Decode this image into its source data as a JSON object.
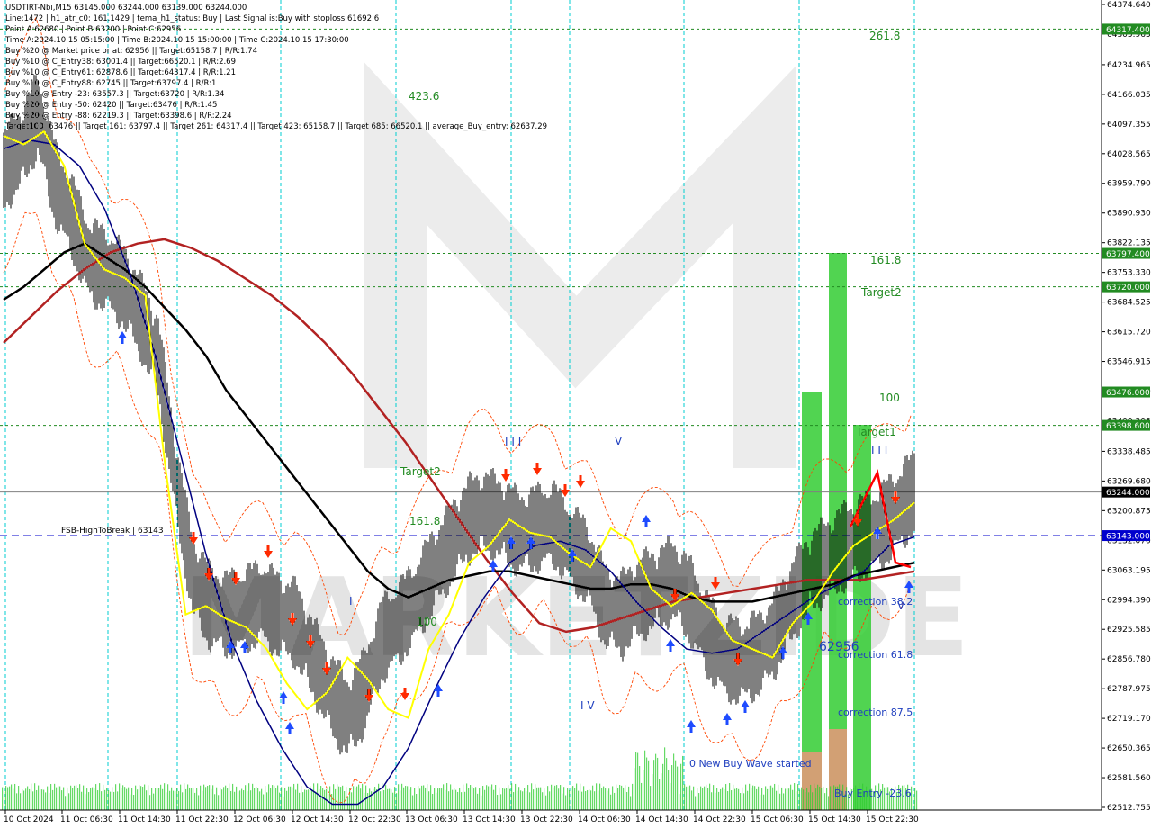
{
  "header": {
    "lines": [
      "USDTIRT-Nbi,M15  63145.000 63244.000 63139.000 63244.000",
      "Line:1472 | h1_atr_c0: 161.1429 | tema_h1_status: Buy | Last Signal is:Buy with stoploss:61692.6",
      "Point A:62680 | Point B:63200 | Point C:62956",
      "Time A:2024.10.15 05:15:00 | Time B:2024.10.15 15:00:00 | Time C:2024.10.15 17:30:00",
      "Buy %20 @ Market price or at: 62956 || Target:65158.7 | R/R:1.74",
      "Buy %10 @ C_Entry38: 63001.4 || Target:66520.1 | R/R:2.69",
      "Buy %10 @ C_Entry61: 62878.6 || Target:64317.4 | R/R:1.21",
      "Buy %10 @ C_Entry88: 62745 || Target:63797.4 | R/R:1",
      "Buy %10 @ Entry -23: 63557.3 || Target:63720 | R/R:1.34",
      "Buy %20 @ Entry -50: 62420 || Target:63476 | R/R:1.45",
      "Buy %20 @ Entry -88: 62219.3 || Target:63398.6 | R/R:2.24",
      "Target100: 63476 || Target 161: 63797.4 || Target 261: 64317.4 || Target 423: 65158.7 || Target 685: 66520.1 || average_Buy_entry: 62637.29"
    ]
  },
  "watermark": "MARKETZIDE",
  "colors": {
    "background": "#ffffff",
    "price_line": "#000000",
    "ema_black": "#000000",
    "ema_red": "#b22222",
    "ema_navy": "#000080",
    "ema_yellow": "#ffff00",
    "green_level": "#228b22",
    "blue_level": "#0000cd",
    "target_bar": "#32cd32",
    "entry_bar": "#e9967a",
    "sell_arrow": "#ff2a00",
    "buy_arrow": "#1e4bff",
    "envelope": "#ff4500",
    "volume": "#32cd32",
    "vertical_grid": "#00ced1"
  },
  "chart_data": {
    "type": "candlestick",
    "symbol": "USDTIRT-Nbi",
    "timeframe": "M15",
    "ohlc_last": {
      "open": 63145.0,
      "high": 63244.0,
      "low": 63139.0,
      "close": 63244.0
    },
    "ylim": [
      62512.755,
      64374.64
    ],
    "y_ticks": [
      "64374.640",
      "64305.965",
      "64234.965",
      "64166.035",
      "64097.355",
      "64028.565",
      "63959.790",
      "63890.930",
      "63822.135",
      "63753.330",
      "63684.525",
      "63615.720",
      "63546.915",
      "63478.110",
      "63409.305",
      "63338.485",
      "63269.680",
      "63200.875",
      "63132.070",
      "63063.195",
      "62994.390",
      "62925.585",
      "62856.780",
      "62787.975",
      "62719.170",
      "62650.365",
      "62581.560",
      "62512.755"
    ],
    "x_ticks": [
      "10 Oct 2024",
      "11 Oct 06:30",
      "11 Oct 14:30",
      "11 Oct 22:30",
      "12 Oct 06:30",
      "12 Oct 14:30",
      "12 Oct 22:30",
      "13 Oct 06:30",
      "13 Oct 14:30",
      "13 Oct 22:30",
      "14 Oct 06:30",
      "14 Oct 14:30",
      "14 Oct 22:30",
      "15 Oct 06:30",
      "15 Oct 14:30",
      "15 Oct 22:30"
    ],
    "price_levels": [
      {
        "value": 64317.4,
        "label": "64317.400",
        "kind": "target"
      },
      {
        "value": 63797.4,
        "label": "63797.400",
        "kind": "target"
      },
      {
        "value": 63720.0,
        "label": "63720.000",
        "kind": "target"
      },
      {
        "value": 63476.0,
        "label": "63476.000",
        "kind": "target"
      },
      {
        "value": 63398.6,
        "label": "63398.600",
        "kind": "target"
      },
      {
        "value": 63244.0,
        "label": "63244.000",
        "kind": "current"
      },
      {
        "value": 63143.0,
        "label": "63143.000",
        "kind": "fsb"
      }
    ],
    "fsb_label": "FSB-HighToBreak | 63143",
    "annotations": {
      "green": [
        "261.8",
        "423.6",
        "161.8",
        "Target2",
        "100",
        "Target1",
        "Target2",
        "161.8",
        "100"
      ],
      "blue": [
        "correction 38.2",
        "correction 61.8",
        "correction 87.5",
        "0 New Buy Wave started",
        "Buy Entry -23.6",
        "62956",
        "I V",
        "I",
        "V",
        "I I I",
        "I I I",
        "V"
      ]
    },
    "series": {
      "close": [
        63990,
        64040,
        64120,
        63960,
        63880,
        63780,
        63760,
        63720,
        63650,
        63560,
        63280,
        63050,
        62980,
        62960,
        62970,
        62990,
        62960,
        62940,
        62860,
        62780,
        62720,
        62780,
        62900,
        62940,
        62990,
        63060,
        63120,
        63180,
        63200,
        63180,
        63150,
        63160,
        63170,
        63120,
        63080,
        62980,
        62960,
        63000,
        63020,
        63040,
        62990,
        62910,
        62860,
        62850,
        62870,
        62920,
        63000,
        63060,
        63090,
        63120,
        63140,
        63160,
        63200,
        63244
      ],
      "ema_black": [
        63690,
        63720,
        63760,
        63800,
        63820,
        63790,
        63760,
        63720,
        63670,
        63620,
        63560,
        63480,
        63420,
        63360,
        63300,
        63240,
        63180,
        63120,
        63060,
        63020,
        63000,
        63020,
        63040,
        63050,
        63060,
        63060,
        63050,
        63040,
        63030,
        63020,
        63020,
        63030,
        63030,
        63020,
        63000,
        62990,
        62990,
        62990,
        63000,
        63010,
        63020,
        63030,
        63050,
        63060,
        63070,
        63080
      ],
      "ema_red": [
        63590,
        63650,
        63710,
        63760,
        63800,
        63820,
        63830,
        63810,
        63780,
        63740,
        63700,
        63650,
        63590,
        63520,
        63440,
        63360,
        63270,
        63180,
        63090,
        63010,
        62940,
        62920,
        62930,
        62950,
        62970,
        62990,
        63000,
        63010,
        63020,
        63030,
        63040,
        63040,
        63040,
        63050,
        63060
      ],
      "ema_navy": [
        64040,
        64060,
        64050,
        64000,
        63900,
        63750,
        63560,
        63330,
        63100,
        62900,
        62760,
        62650,
        62560,
        62520,
        62520,
        62560,
        62650,
        62780,
        62900,
        63000,
        63080,
        63120,
        63130,
        63110,
        63060,
        62990,
        62930,
        62880,
        62870,
        62880,
        62920,
        62960,
        63000,
        63030,
        63060,
        63120,
        63140
      ],
      "ema_yellow": [
        64070,
        64050,
        64080,
        64000,
        63820,
        63760,
        63740,
        63700,
        63300,
        62960,
        62980,
        62950,
        62930,
        62880,
        62800,
        62740,
        62780,
        62860,
        62810,
        62740,
        62720,
        62880,
        62960,
        63080,
        63120,
        63180,
        63150,
        63140,
        63100,
        63070,
        63160,
        63130,
        63020,
        62980,
        63010,
        62970,
        62900,
        62880,
        62860,
        62940,
        62990,
        63060,
        63120,
        63150,
        63180,
        63220
      ]
    },
    "grid": false,
    "legend": "none"
  }
}
